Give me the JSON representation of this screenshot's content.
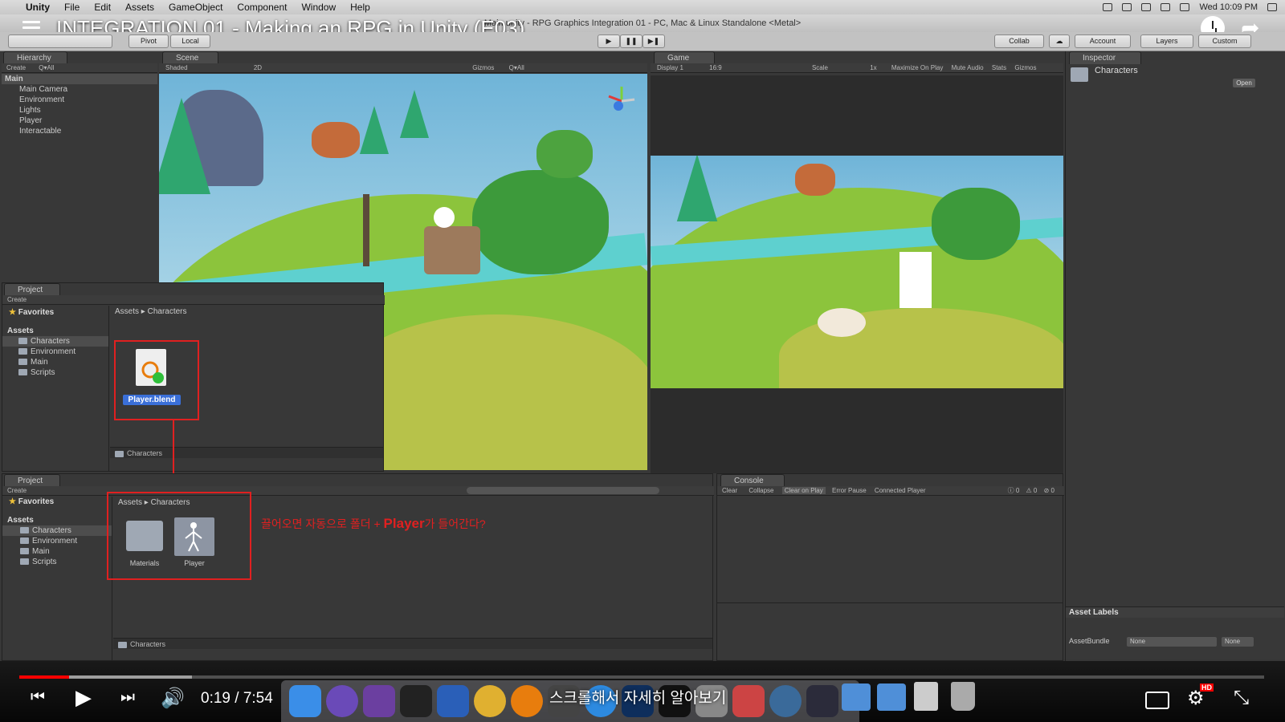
{
  "mac_menu": {
    "apple": "",
    "items": [
      "Unity",
      "File",
      "Edit",
      "Assets",
      "GameObject",
      "Component",
      "Window",
      "Help"
    ],
    "clock": "Wed 10:09 PM"
  },
  "unity_title": "Main.unity - RPG Graphics Integration 01 - PC, Mac & Linux Standalone <Metal>",
  "video_title": "INTEGRATION 01 - Making an RPG in Unity (E03)",
  "toolbar": {
    "pivot": "Pivot",
    "local": "Local",
    "collab": "Collab",
    "account": "Account",
    "layers": "Layers",
    "layout": "Custom"
  },
  "hierarchy": {
    "tab": "Hierarchy",
    "create": "Create",
    "search": "Q▾All",
    "scene": "Main",
    "items": [
      "Main Camera",
      "Environment",
      "Lights",
      "Player",
      "Interactable"
    ]
  },
  "scene": {
    "tab": "Scene",
    "shading": "Shaded",
    "mode2d": "2D",
    "gizmos": "Gizmos",
    "search": "Q▾All"
  },
  "game": {
    "tab": "Game",
    "display": "Display 1",
    "aspect": "16:9",
    "scale_label": "Scale",
    "scale_value": "1x",
    "maximize": "Maximize On Play",
    "mute": "Mute Audio",
    "stats": "Stats",
    "gizmos": "Gizmos"
  },
  "inspector": {
    "tab": "Inspector",
    "object": "Characters",
    "open": "Open",
    "asset_labels": "Asset Labels",
    "assetbundle_label": "AssetBundle",
    "assetbundle_value": "None",
    "variant_value": "None"
  },
  "project_top": {
    "tab": "Project",
    "create": "Create",
    "favorites": "Favorites",
    "assets": "Assets",
    "folders": [
      "Characters",
      "Environment",
      "Main",
      "Scripts"
    ],
    "breadcrumb": [
      "Assets",
      "Characters"
    ],
    "file": "Player.blend",
    "footer": "Characters"
  },
  "project_bottom": {
    "tab": "Project",
    "create": "Create",
    "favorites": "Favorites",
    "assets": "Assets",
    "folders": [
      "Characters",
      "Environment",
      "Main",
      "Scripts"
    ],
    "breadcrumb": [
      "Assets",
      "Characters"
    ],
    "items": [
      "Materials",
      "Player"
    ],
    "footer": "Characters"
  },
  "console": {
    "tab": "Console",
    "buttons": [
      "Clear",
      "Collapse",
      "Clear on Play",
      "Error Pause",
      "Connected Player"
    ],
    "counts": [
      "0",
      "0",
      "0"
    ]
  },
  "annotation": {
    "part1": "끌어오면 자동으로 폴더 + ",
    "part2": "Player",
    "part3": "가 들어간다?"
  },
  "player": {
    "time": "0:19 / 7:54",
    "progress_fraction": 0.0403,
    "caption": "스크롤해서 자세히 알아보기"
  },
  "colors": {
    "unity_dark": "#383838",
    "annotation_red": "#e02020",
    "yt_red": "#ff0000",
    "grass": "#8cc43c"
  }
}
